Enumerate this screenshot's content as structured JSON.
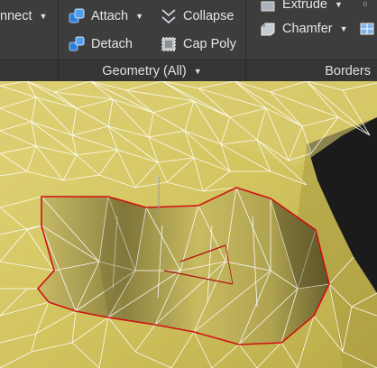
{
  "ribbon": {
    "connect_label": "nnect",
    "attach_label": "Attach",
    "collapse_label": "Collapse",
    "detach_label": "Detach",
    "cap_poly_label": "Cap Poly",
    "extrude_label": "Extrude",
    "chamfer_label": "Chamfer",
    "geometry_panel_label": "Geometry (All)",
    "borders_panel_label": "Borders"
  },
  "icons": {
    "attach": "attach-icon",
    "detach": "detach-icon",
    "collapse": "collapse-icon",
    "cap_poly": "cap-poly-icon",
    "extrude": "extrude-icon",
    "chamfer": "chamfer-icon",
    "bridge": "bridge-icon"
  },
  "colors": {
    "ribbon_bg": "#3d3d3d",
    "mesh_fill": "#cfc36a",
    "wire": "#ffffff",
    "border_selection": "#d01010",
    "icon_blue": "#3a8ee6"
  }
}
